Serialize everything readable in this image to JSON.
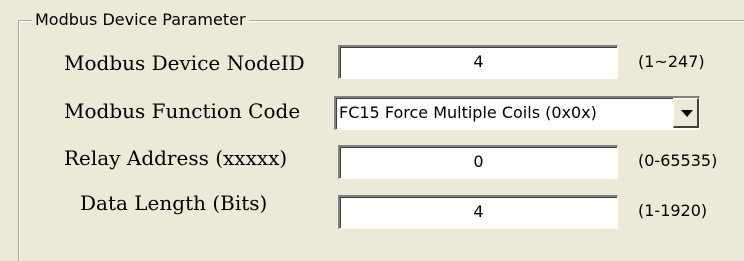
{
  "group": {
    "title": "Modbus Device Parameter"
  },
  "fields": {
    "node_id": {
      "label": "Modbus Device NodeID",
      "value": "4",
      "range": "(1~247)"
    },
    "function_code": {
      "label": "Modbus Function Code",
      "selected": "FC15 Force Multiple Coils (0x0x)",
      "dropdown_icon": "chevron-down-icon"
    },
    "relay_address": {
      "label": "Relay Address (xxxxx)",
      "value": "0",
      "range": "(0-65535)"
    },
    "data_length": {
      "label": "Data Length (Bits)",
      "value": "4",
      "range": "(1-1920)"
    }
  }
}
